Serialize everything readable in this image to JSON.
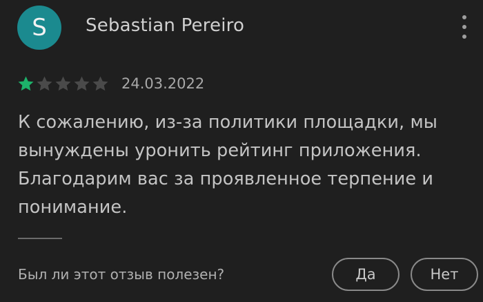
{
  "review": {
    "avatar_letter": "S",
    "avatar_color": "#1b8a8f",
    "author_name": "Sebastian Pereiro",
    "more_icon": "more-vert-icon",
    "rating": 1,
    "rating_max": 5,
    "star_filled_color": "#1db36a",
    "star_empty_color": "#4a4a4a",
    "date": "24.03.2022",
    "text": "К сожалению, из-за политики площадки, мы вынуждены уронить рейтинг приложения. Благодарим вас за проявленное терпение и понимание."
  },
  "feedback": {
    "question": "Был ли этот отзыв полезен?",
    "yes_label": "Да",
    "no_label": "Нет"
  }
}
